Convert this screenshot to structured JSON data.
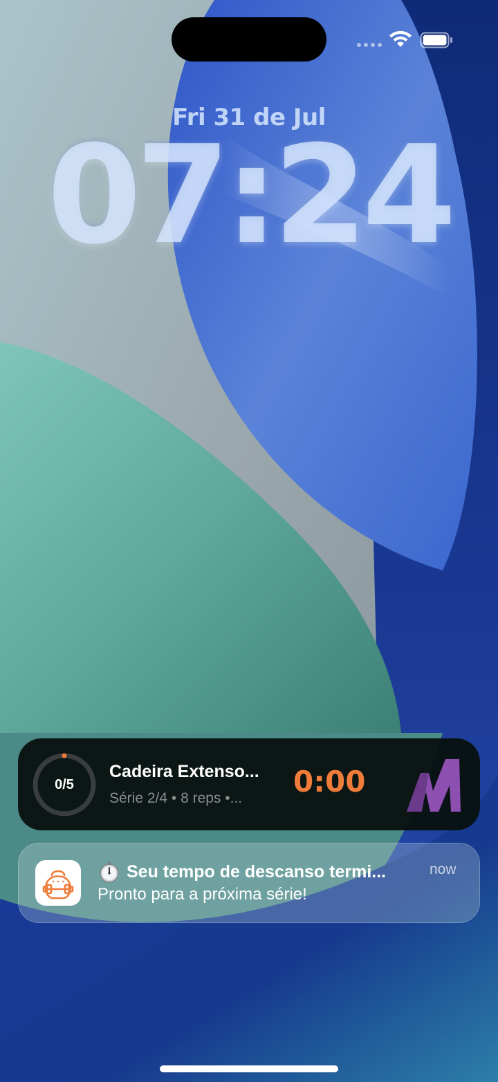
{
  "status_bar": {
    "wifi_icon": "wifi-icon",
    "battery_icon": "battery-full-icon",
    "signal_icon": "cellular-dots-icon"
  },
  "lock_screen": {
    "date": "Fri 31 de Jul",
    "time": "07:24"
  },
  "live_activity": {
    "progress_label": "0/5",
    "progress_fraction": 0,
    "exercise_title": "Cadeira Extenso...",
    "details": "Série 2/4 • 8 reps •...",
    "timer": "0:00",
    "timer_color": "#f07c3a",
    "logo_icon": "app-logo-m-icon",
    "logo_color": "#8d4fb0"
  },
  "notification": {
    "app_icon": "kettlebell-dumbbell-icon",
    "icon_color": "#f07c3a",
    "title_emoji": "stopwatch-icon",
    "title": "Seu tempo de descanso termi...",
    "body": "Pronto para a próxima série!",
    "time": "now"
  }
}
